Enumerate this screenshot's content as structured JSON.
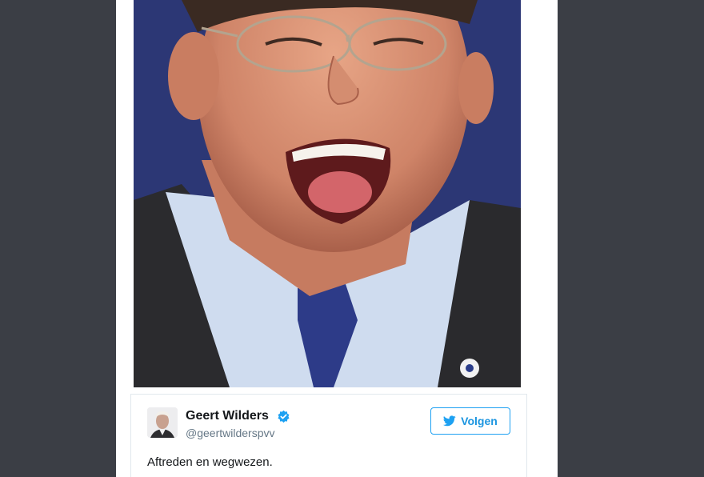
{
  "tweet": {
    "author_name": "Geert Wilders",
    "author_handle": "@geertwilderspvv",
    "verified": true,
    "follow_label": "Volgen",
    "text": "Aftreden en wegwezen."
  },
  "icons": {
    "verified": "verified-badge-icon",
    "follow": "twitter-bird-icon"
  },
  "colors": {
    "background": "#3b3e45",
    "accent": "#1da1f2",
    "name_text": "#14171a",
    "handle_text": "#657786"
  }
}
